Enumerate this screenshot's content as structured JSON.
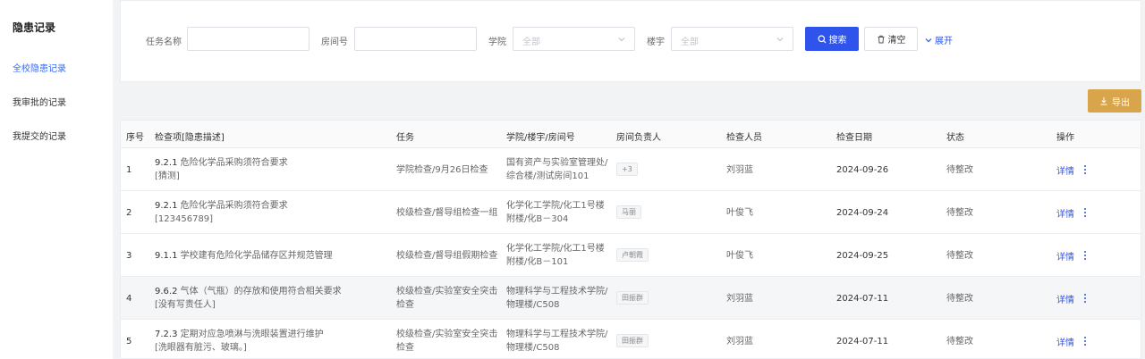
{
  "sidebar": {
    "title": "隐患记录",
    "items": [
      {
        "label": "全校隐患记录",
        "active": true
      },
      {
        "label": "我审批的记录",
        "active": false
      },
      {
        "label": "我提交的记录",
        "active": false
      }
    ]
  },
  "filters": {
    "task_name_label": "任务名称",
    "room_label": "房间号",
    "college_label": "学院",
    "college_placeholder": "全部",
    "building_label": "楼宇",
    "building_placeholder": "全部",
    "search_label": "搜索",
    "clear_label": "清空",
    "expand_label": "展开"
  },
  "toolbar": {
    "export_label": "导出"
  },
  "colors": {
    "primary": "#2f54eb",
    "export": "#d9a54a",
    "active_nav": "#2f6bff"
  },
  "table": {
    "columns": [
      "序号",
      "检查项[隐患描述]",
      "任务",
      "学院/楼宇/房间号",
      "房间负责人",
      "检查人员",
      "检查日期",
      "状态",
      "操作"
    ],
    "rows": [
      {
        "index": "1",
        "code": "9.2.1",
        "item": "危险化学品采购须符合要求",
        "desc": "[猜测]",
        "task": [
          "学院检查/9月26日检查"
        ],
        "location": [
          "国有资产与实验室管理处/",
          "综合楼/测试房间101"
        ],
        "owner": "+3",
        "inspector": "刘羽蓝",
        "date": "2024-09-26",
        "status": "待整改",
        "detail": "详情"
      },
      {
        "index": "2",
        "code": "9.2.1",
        "item": "危险化学品采购须符合要求",
        "desc": "[123456789]",
        "task": [
          "校级检查/督导组检查一组"
        ],
        "location": [
          "化学化工学院/化工1号楼",
          "附楼/化B－304"
        ],
        "owner": "马丽",
        "inspector": "叶俊飞",
        "date": "2024-09-24",
        "status": "待整改",
        "detail": "详情"
      },
      {
        "index": "3",
        "code": "9.1.1",
        "item": "学校建有危险化学品储存区并规范管理",
        "desc": "",
        "task": [
          "校级检查/督导组假期检查"
        ],
        "location": [
          "化学化工学院/化工1号楼",
          "附楼/化B－101"
        ],
        "owner": "卢朝霞",
        "inspector": "叶俊飞",
        "date": "2024-09-25",
        "status": "待整改",
        "detail": "详情"
      },
      {
        "index": "4",
        "code": "9.6.2",
        "item": "气体（气瓶）的存放和使用符合相关要求",
        "desc": "[没有写责任人]",
        "task": [
          "校级检查/实验室安全突击",
          "检查"
        ],
        "location": [
          "物理科学与工程技术学院/",
          "物理楼/C508"
        ],
        "owner": "田振群",
        "inspector": "刘羽蓝",
        "date": "2024-07-11",
        "status": "待整改",
        "detail": "详情"
      },
      {
        "index": "5",
        "code": "7.2.3",
        "item": "定期对应急喷淋与洗眼装置进行维护",
        "desc": "[洗眼器有脏污、玻璃。]",
        "task": [
          "校级检查/实验室安全突击",
          "检查"
        ],
        "location": [
          "物理科学与工程技术学院/",
          "物理楼/C508"
        ],
        "owner": "田振群",
        "inspector": "刘羽蓝",
        "date": "2024-07-11",
        "status": "待整改",
        "detail": "详情"
      }
    ]
  }
}
